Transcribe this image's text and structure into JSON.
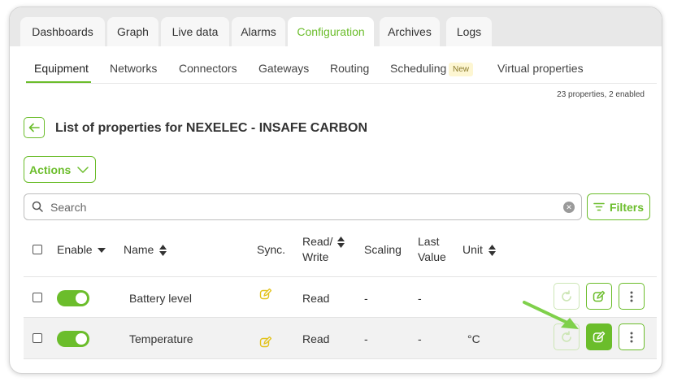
{
  "tabs": [
    {
      "label": "Dashboards"
    },
    {
      "label": "Graph"
    },
    {
      "label": "Live data"
    },
    {
      "label": "Alarms"
    },
    {
      "label": "Configuration",
      "active": true
    },
    {
      "label": "Archives"
    },
    {
      "label": "Logs"
    }
  ],
  "subnav": [
    {
      "label": "Equipment",
      "active": true
    },
    {
      "label": "Networks"
    },
    {
      "label": "Connectors"
    },
    {
      "label": "Gateways"
    },
    {
      "label": "Routing"
    },
    {
      "label": "Scheduling",
      "badge": "New"
    },
    {
      "label": "Virtual properties"
    }
  ],
  "summary": "23 properties, 2 enabled",
  "page_title": "List of properties for NEXELEC - INSAFE CARBON",
  "actions_label": "Actions",
  "search": {
    "placeholder": "Search",
    "value": ""
  },
  "filters_label": "Filters",
  "columns": {
    "enable": "Enable",
    "name": "Name",
    "sync": "Sync.",
    "read_write": "Read/ Write",
    "scaling": "Scaling",
    "last_value": "Last Value",
    "unit": "Unit"
  },
  "rows": [
    {
      "enabled": true,
      "name": "Battery level",
      "read_write": "Read",
      "scaling": "-",
      "last_value": "-",
      "unit": ""
    },
    {
      "enabled": true,
      "name": "Temperature",
      "read_write": "Read",
      "scaling": "-",
      "last_value": "-",
      "unit": "°C"
    }
  ],
  "colors": {
    "accent": "#6bbd2b",
    "sync_icon": "#e2c21a",
    "arrow": "#7fd04b"
  },
  "icons": [
    "back-arrow-icon",
    "chevron-down-icon",
    "search-icon",
    "clear-icon",
    "filter-icon",
    "sort-icon",
    "edit-icon",
    "refresh-icon",
    "more-vertical-icon"
  ]
}
